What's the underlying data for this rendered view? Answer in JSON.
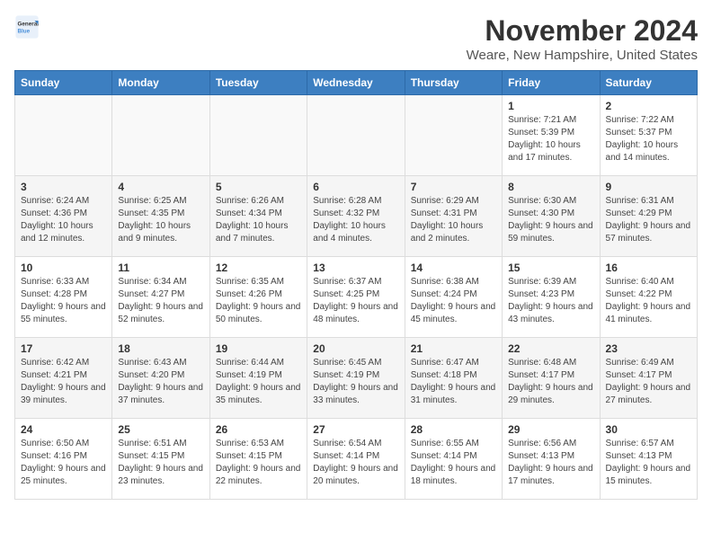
{
  "header": {
    "logo_general": "General",
    "logo_blue": "Blue",
    "month": "November 2024",
    "location": "Weare, New Hampshire, United States"
  },
  "weekdays": [
    "Sunday",
    "Monday",
    "Tuesday",
    "Wednesday",
    "Thursday",
    "Friday",
    "Saturday"
  ],
  "weeks": [
    [
      {
        "day": "",
        "info": ""
      },
      {
        "day": "",
        "info": ""
      },
      {
        "day": "",
        "info": ""
      },
      {
        "day": "",
        "info": ""
      },
      {
        "day": "",
        "info": ""
      },
      {
        "day": "1",
        "info": "Sunrise: 7:21 AM\nSunset: 5:39 PM\nDaylight: 10 hours and 17 minutes."
      },
      {
        "day": "2",
        "info": "Sunrise: 7:22 AM\nSunset: 5:37 PM\nDaylight: 10 hours and 14 minutes."
      }
    ],
    [
      {
        "day": "3",
        "info": "Sunrise: 6:24 AM\nSunset: 4:36 PM\nDaylight: 10 hours and 12 minutes."
      },
      {
        "day": "4",
        "info": "Sunrise: 6:25 AM\nSunset: 4:35 PM\nDaylight: 10 hours and 9 minutes."
      },
      {
        "day": "5",
        "info": "Sunrise: 6:26 AM\nSunset: 4:34 PM\nDaylight: 10 hours and 7 minutes."
      },
      {
        "day": "6",
        "info": "Sunrise: 6:28 AM\nSunset: 4:32 PM\nDaylight: 10 hours and 4 minutes."
      },
      {
        "day": "7",
        "info": "Sunrise: 6:29 AM\nSunset: 4:31 PM\nDaylight: 10 hours and 2 minutes."
      },
      {
        "day": "8",
        "info": "Sunrise: 6:30 AM\nSunset: 4:30 PM\nDaylight: 9 hours and 59 minutes."
      },
      {
        "day": "9",
        "info": "Sunrise: 6:31 AM\nSunset: 4:29 PM\nDaylight: 9 hours and 57 minutes."
      }
    ],
    [
      {
        "day": "10",
        "info": "Sunrise: 6:33 AM\nSunset: 4:28 PM\nDaylight: 9 hours and 55 minutes."
      },
      {
        "day": "11",
        "info": "Sunrise: 6:34 AM\nSunset: 4:27 PM\nDaylight: 9 hours and 52 minutes."
      },
      {
        "day": "12",
        "info": "Sunrise: 6:35 AM\nSunset: 4:26 PM\nDaylight: 9 hours and 50 minutes."
      },
      {
        "day": "13",
        "info": "Sunrise: 6:37 AM\nSunset: 4:25 PM\nDaylight: 9 hours and 48 minutes."
      },
      {
        "day": "14",
        "info": "Sunrise: 6:38 AM\nSunset: 4:24 PM\nDaylight: 9 hours and 45 minutes."
      },
      {
        "day": "15",
        "info": "Sunrise: 6:39 AM\nSunset: 4:23 PM\nDaylight: 9 hours and 43 minutes."
      },
      {
        "day": "16",
        "info": "Sunrise: 6:40 AM\nSunset: 4:22 PM\nDaylight: 9 hours and 41 minutes."
      }
    ],
    [
      {
        "day": "17",
        "info": "Sunrise: 6:42 AM\nSunset: 4:21 PM\nDaylight: 9 hours and 39 minutes."
      },
      {
        "day": "18",
        "info": "Sunrise: 6:43 AM\nSunset: 4:20 PM\nDaylight: 9 hours and 37 minutes."
      },
      {
        "day": "19",
        "info": "Sunrise: 6:44 AM\nSunset: 4:19 PM\nDaylight: 9 hours and 35 minutes."
      },
      {
        "day": "20",
        "info": "Sunrise: 6:45 AM\nSunset: 4:19 PM\nDaylight: 9 hours and 33 minutes."
      },
      {
        "day": "21",
        "info": "Sunrise: 6:47 AM\nSunset: 4:18 PM\nDaylight: 9 hours and 31 minutes."
      },
      {
        "day": "22",
        "info": "Sunrise: 6:48 AM\nSunset: 4:17 PM\nDaylight: 9 hours and 29 minutes."
      },
      {
        "day": "23",
        "info": "Sunrise: 6:49 AM\nSunset: 4:17 PM\nDaylight: 9 hours and 27 minutes."
      }
    ],
    [
      {
        "day": "24",
        "info": "Sunrise: 6:50 AM\nSunset: 4:16 PM\nDaylight: 9 hours and 25 minutes."
      },
      {
        "day": "25",
        "info": "Sunrise: 6:51 AM\nSunset: 4:15 PM\nDaylight: 9 hours and 23 minutes."
      },
      {
        "day": "26",
        "info": "Sunrise: 6:53 AM\nSunset: 4:15 PM\nDaylight: 9 hours and 22 minutes."
      },
      {
        "day": "27",
        "info": "Sunrise: 6:54 AM\nSunset: 4:14 PM\nDaylight: 9 hours and 20 minutes."
      },
      {
        "day": "28",
        "info": "Sunrise: 6:55 AM\nSunset: 4:14 PM\nDaylight: 9 hours and 18 minutes."
      },
      {
        "day": "29",
        "info": "Sunrise: 6:56 AM\nSunset: 4:13 PM\nDaylight: 9 hours and 17 minutes."
      },
      {
        "day": "30",
        "info": "Sunrise: 6:57 AM\nSunset: 4:13 PM\nDaylight: 9 hours and 15 minutes."
      }
    ]
  ]
}
